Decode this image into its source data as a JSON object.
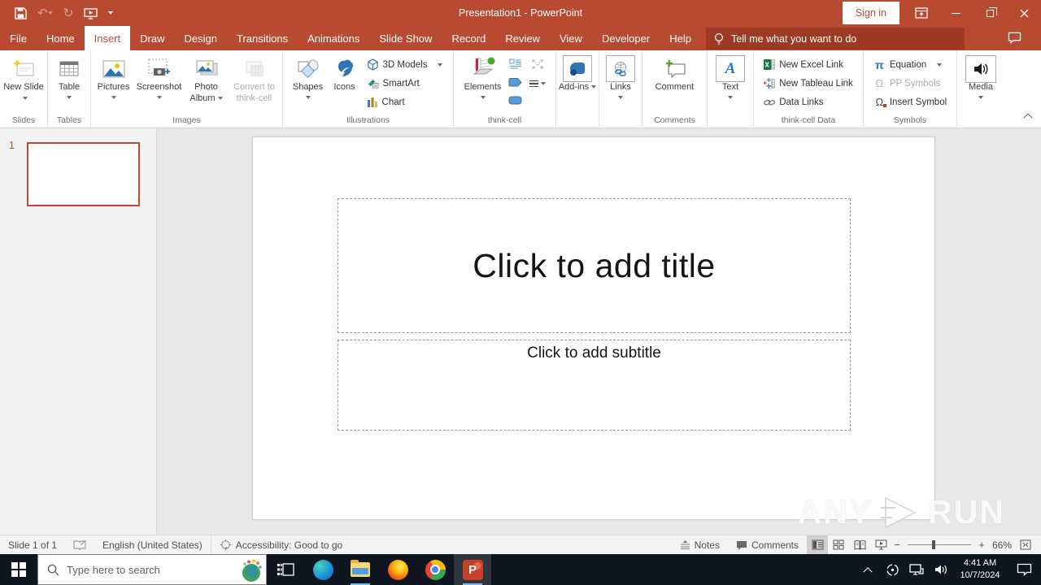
{
  "titlebar": {
    "title": "Presentation1 - PowerPoint",
    "sign_in": "Sign in"
  },
  "tabs": [
    {
      "label": "File"
    },
    {
      "label": "Home"
    },
    {
      "label": "Insert"
    },
    {
      "label": "Draw"
    },
    {
      "label": "Design"
    },
    {
      "label": "Transitions"
    },
    {
      "label": "Animations"
    },
    {
      "label": "Slide Show"
    },
    {
      "label": "Record"
    },
    {
      "label": "Review"
    },
    {
      "label": "View"
    },
    {
      "label": "Developer"
    },
    {
      "label": "Help"
    }
  ],
  "tellme": "Tell me what you want to do",
  "ribbon": {
    "slides": {
      "group": "Slides",
      "new_slide": "New Slide"
    },
    "tables": {
      "group": "Tables",
      "table": "Table"
    },
    "images": {
      "group": "Images",
      "pictures": "Pictures",
      "screenshot": "Screenshot",
      "photo_album": "Photo Album",
      "convert": "Convert to think-cell"
    },
    "illustrations": {
      "group": "Illustrations",
      "shapes": "Shapes",
      "icons": "Icons",
      "models": "3D Models",
      "smartart": "SmartArt",
      "chart": "Chart"
    },
    "thinkcell": {
      "group": "think-cell",
      "elements": "Elements"
    },
    "addins": {
      "label": "Add-ins"
    },
    "links": {
      "label": "Links"
    },
    "comments": {
      "group": "Comments",
      "comment": "Comment"
    },
    "text": {
      "label": "Text",
      "a_glyph": "A"
    },
    "tcdata": {
      "group": "think-cell Data",
      "excel": "New Excel Link",
      "tableau": "New Tableau Link",
      "datalinks": "Data Links"
    },
    "symbols": {
      "group": "Symbols",
      "equation": "Equation",
      "pp_symbols": "PP Symbols",
      "insert_symbol": "Insert Symbol",
      "pi": "π",
      "omega": "Ω"
    },
    "media": {
      "label": "Media"
    }
  },
  "slide": {
    "number": "1",
    "title_placeholder": "Click to add title",
    "subtitle_placeholder": "Click to add subtitle"
  },
  "watermark": {
    "left": "ANY",
    "right": "RUN"
  },
  "statusbar": {
    "slide_indicator": "Slide 1 of 1",
    "language": "English (United States)",
    "accessibility": "Accessibility: Good to go",
    "notes": "Notes",
    "comments": "Comments",
    "zoom_out": "−",
    "zoom_in": "+",
    "zoom_level": "66%"
  },
  "taskbar": {
    "search_placeholder": "Type here to search",
    "ppt_letter": "P",
    "time": "4:41 AM",
    "date": "10/7/2024"
  },
  "colors": {
    "accent": "#b94a32",
    "tellme_bg": "#9e3a23",
    "taskbar_bg": "#10161f",
    "thumbnail_border": "#c14a2e"
  }
}
